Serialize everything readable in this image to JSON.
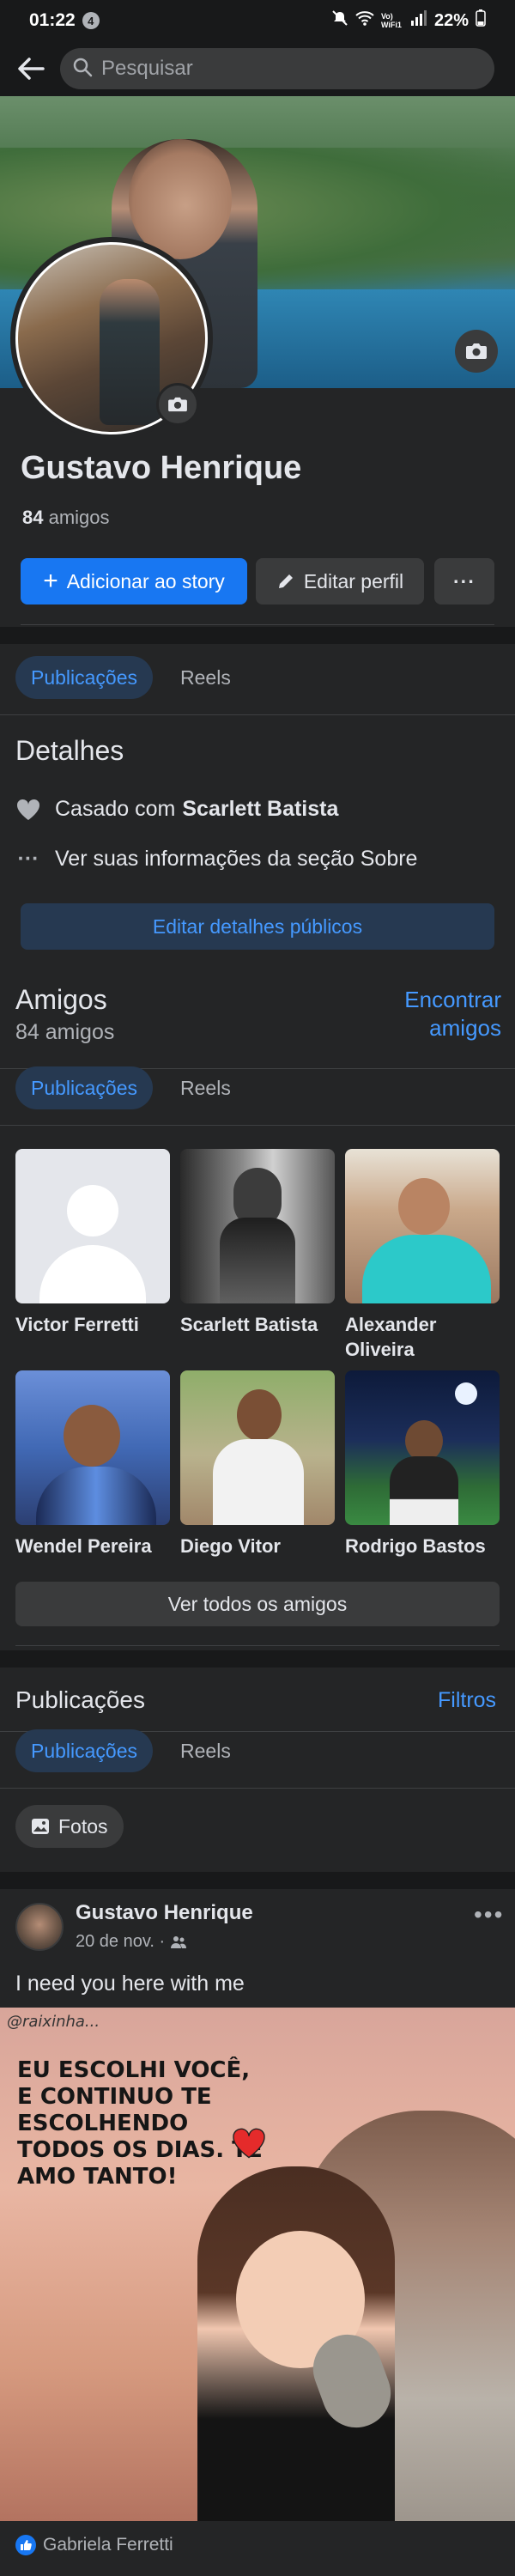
{
  "status_bar": {
    "time": "01:22",
    "notification_count": "4",
    "network_label": "Vo) WiFi1",
    "battery": "22%"
  },
  "search": {
    "placeholder": "Pesquisar"
  },
  "profile": {
    "name": "Gustavo Henrique",
    "friends_count": "84",
    "friends_label": "amigos",
    "add_story_label": "Adicionar ao story",
    "edit_profile_label": "Editar perfil",
    "more_label": "···"
  },
  "tabs": [
    {
      "label": "Publicações",
      "active": true
    },
    {
      "label": "Reels",
      "active": false
    }
  ],
  "details": {
    "title": "Detalhes",
    "relationship_prefix": "Casado com",
    "relationship_partner": "Scarlett Batista",
    "about_link": "Ver suas informações da seção Sobre",
    "edit_button": "Editar detalhes públicos"
  },
  "friends": {
    "title": "Amigos",
    "subtitle": "84 amigos",
    "find_line1": "Encontrar",
    "find_line2": "amigos",
    "list": [
      {
        "name": "Victor Ferretti"
      },
      {
        "name": "Scarlett Batista"
      },
      {
        "name": "Alexander Oliveira"
      },
      {
        "name": "Wendel Pereira"
      },
      {
        "name": "Diego Vitor"
      },
      {
        "name": "Rodrigo Bastos"
      }
    ],
    "see_all": "Ver todos os amigos"
  },
  "posts_section": {
    "title": "Publicações",
    "filters": "Filtros",
    "photos_chip": "Fotos"
  },
  "post": {
    "author": "Gustavo Henrique",
    "date": "20 de nov. ·",
    "text": "I need you here with me",
    "image_handle": "@raixinha...",
    "image_quote": "Eu escolhi você, e continuo te escolhendo todos os dias. Te amo tanto!",
    "reactor": "Gabriela Ferretti"
  },
  "colors": {
    "accent": "#1877f2",
    "link": "#4599ff",
    "background": "#242526",
    "tab_active_bg": "#263951"
  }
}
